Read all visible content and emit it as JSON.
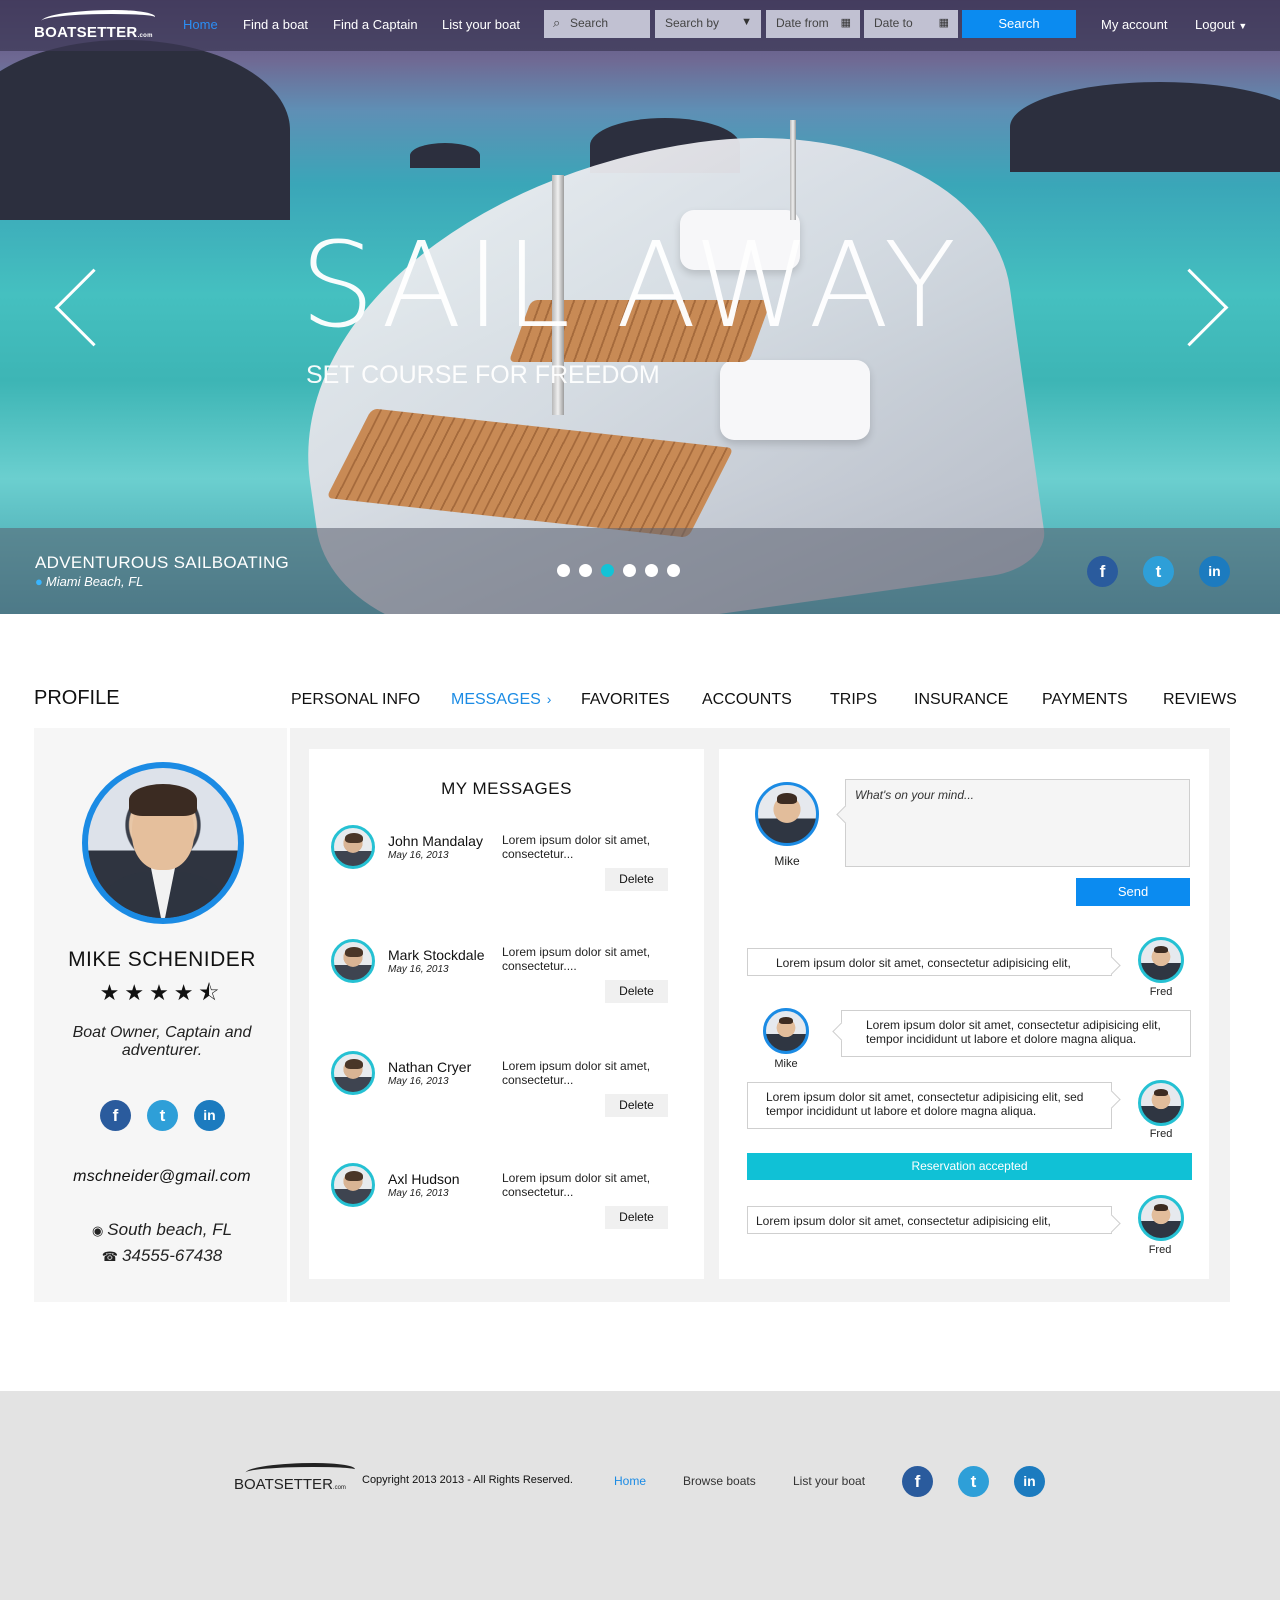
{
  "header": {
    "logo_text": "BOATSETTER",
    "logo_suffix": ".com",
    "nav": [
      "Home",
      "Find a boat",
      "Find a Captain",
      "List your boat"
    ],
    "search_placeholder": "Search",
    "search_by": "Search by",
    "date_from": "Date from",
    "date_to": "Date to",
    "search_button": "Search",
    "my_account": "My account",
    "logout": "Logout"
  },
  "hero": {
    "title": "SAIL AWAY",
    "subtitle": "SET COURSE FOR FREEDOM",
    "caption_title": "ADVENTUROUS SAILBOATING",
    "caption_location": "Miami Beach, FL",
    "slide_count": 6,
    "active_slide": 3
  },
  "profile": {
    "heading": "PROFILE",
    "tabs": [
      "PERSONAL INFO",
      "MESSAGES",
      "FAVORITES",
      "ACCOUNTS",
      "TRIPS",
      "INSURANCE",
      "PAYMENTS",
      "REVIEWS"
    ],
    "active_tab": "MESSAGES",
    "name": "MIKE SCHENIDER",
    "rating": 4.5,
    "stars_text": "★★★★⯪",
    "bio": "Boat Owner, Captain and adventurer.",
    "email": "mschneider@gmail.com",
    "location": "South beach, FL",
    "phone": "34555-67438"
  },
  "messages": {
    "title": "MY MESSAGES",
    "delete_label": "Delete",
    "items": [
      {
        "name": "John Mandalay",
        "date": "May 16, 2013",
        "text": "Lorem ipsum dolor sit amet, consectetur..."
      },
      {
        "name": "Mark Stockdale",
        "date": "May 16, 2013",
        "text": "Lorem ipsum dolor sit amet, consectetur...."
      },
      {
        "name": "Nathan Cryer",
        "date": "May 16, 2013",
        "text": "Lorem ipsum dolor sit amet, consectetur..."
      },
      {
        "name": "Axl Hudson",
        "date": "May 16, 2013",
        "text": "Lorem ipsum dolor sit amet, consectetur..."
      }
    ]
  },
  "chat": {
    "self_name": "Mike",
    "compose_placeholder": "What's on your mind...",
    "send_label": "Send",
    "reservation_label": "Reservation accepted",
    "thread": [
      {
        "from": "Fred",
        "text": "Lorem ipsum dolor sit amet, consectetur adipisicing elit,"
      },
      {
        "from": "Mike",
        "text": "Lorem ipsum dolor sit amet, consectetur adipisicing elit, tempor incididunt ut labore et dolore magna aliqua."
      },
      {
        "from": "Fred",
        "text": "Lorem ipsum dolor sit amet, consectetur adipisicing elit, sed tempor incididunt ut labore et dolore magna aliqua."
      },
      {
        "from": "Fred",
        "text": "Lorem ipsum dolor sit amet, consectetur adipisicing elit,"
      }
    ]
  },
  "footer": {
    "logo_text": "BOATSETTER",
    "logo_suffix": ".com",
    "copyright": "Copyright 2013 2013 - All Rights Reserved.",
    "links": [
      "Home",
      "Browse boats",
      "List your boat"
    ]
  },
  "social": {
    "facebook": "f",
    "twitter": "t",
    "linkedin": "in"
  },
  "colors": {
    "accent": "#0b8bf0",
    "teal": "#10c1d6",
    "facebook": "#2a5b9d",
    "twitter": "#2e9fd8",
    "linkedin": "#1c7bbf"
  }
}
